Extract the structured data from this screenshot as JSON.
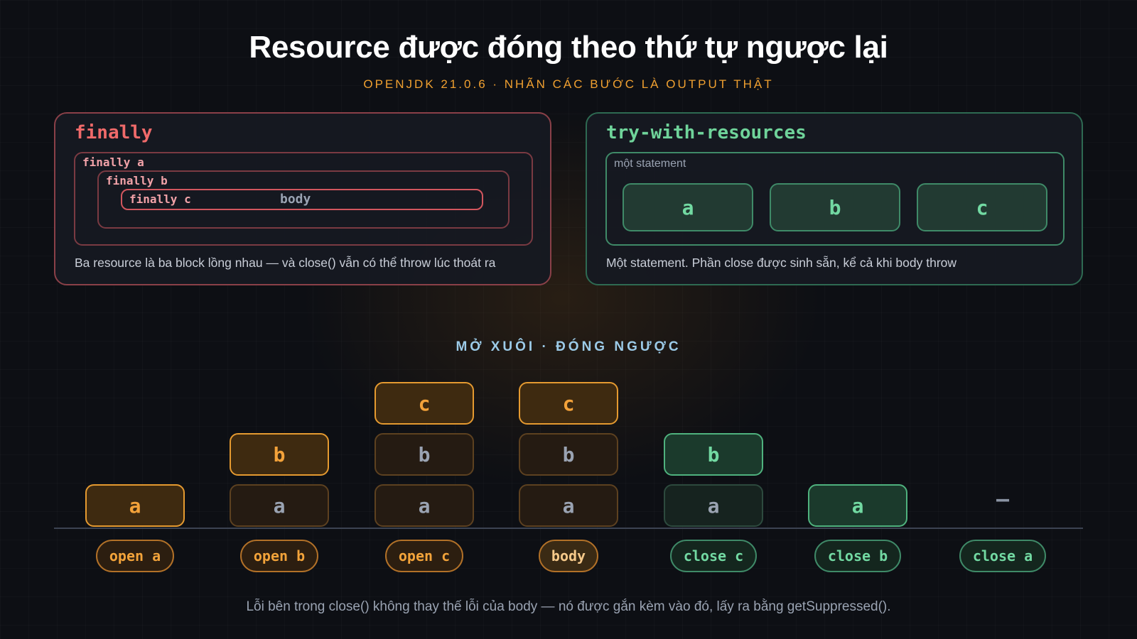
{
  "header": {
    "title": "Resource được đóng theo thứ tự ngược lại",
    "subtitle": "OPENJDK 21.0.6 · NHÃN CÁC BƯỚC LÀ OUTPUT THẬT"
  },
  "finally_panel": {
    "title": "finally",
    "nest_labels": [
      "finally a",
      "finally b",
      "finally c"
    ],
    "body_label": "body",
    "caption": "Ba resource là ba block lồng nhau — và close() vẫn có thể throw lúc thoát ra"
  },
  "twr_panel": {
    "title": "try-with-resources",
    "statement_label": "một statement",
    "resources": [
      "a",
      "b",
      "c"
    ],
    "caption": "Một statement. Phần close được sinh sẵn, kể cả khi body throw"
  },
  "stack_section": {
    "label": "MỞ XUÔI · ĐÓNG NGƯỢC",
    "empty_marker": "—",
    "steps": [
      {
        "label": "open a",
        "stack": [
          "a"
        ],
        "phase": "open"
      },
      {
        "label": "open b",
        "stack": [
          "a",
          "b"
        ],
        "phase": "open"
      },
      {
        "label": "open c",
        "stack": [
          "a",
          "b",
          "c"
        ],
        "phase": "open"
      },
      {
        "label": "body",
        "stack": [
          "a",
          "b",
          "c"
        ],
        "phase": "body"
      },
      {
        "label": "close c",
        "stack": [
          "a",
          "b"
        ],
        "phase": "close"
      },
      {
        "label": "close b",
        "stack": [
          "a"
        ],
        "phase": "close"
      },
      {
        "label": "close a",
        "stack": [],
        "phase": "close"
      }
    ]
  },
  "footer": {
    "note": "Lỗi bên trong close() không thay thế lỗi của body — nó được gắn kèm vào đó, lấy ra bằng getSuppressed()."
  },
  "colors": {
    "open_accent": "#f0a030",
    "close_accent": "#72d9a2",
    "finally_accent": "#f06a6a"
  }
}
